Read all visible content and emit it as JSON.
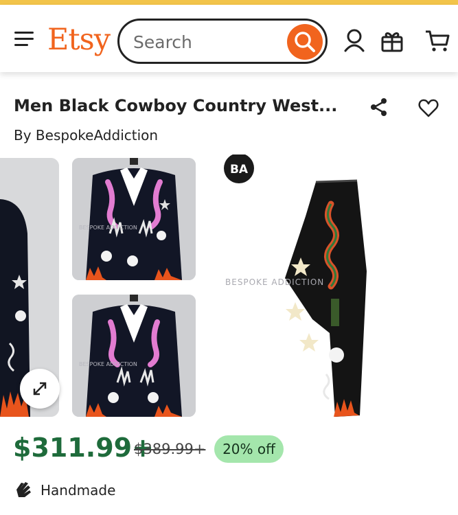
{
  "header": {
    "logo": "Etsy",
    "search_placeholder": "Search",
    "icons": [
      "menu-icon",
      "search-icon",
      "account-icon",
      "gift-icon",
      "cart-icon"
    ]
  },
  "listing": {
    "title": "Men Black Cowboy Country West...",
    "byline_prefix": "By",
    "shop_name": "BespokeAddiction",
    "watermark": "BESPOKE ADDICTION",
    "brand_badge": "BA",
    "price": "$311.99+",
    "original_price": "$389.99+",
    "discount": "20% off",
    "highlight": "Handmade"
  },
  "colors": {
    "brand": "#f1641e",
    "price": "#1e6b3b",
    "discount_bg": "#a4e6ac",
    "top_strip": "#f2c44a"
  }
}
